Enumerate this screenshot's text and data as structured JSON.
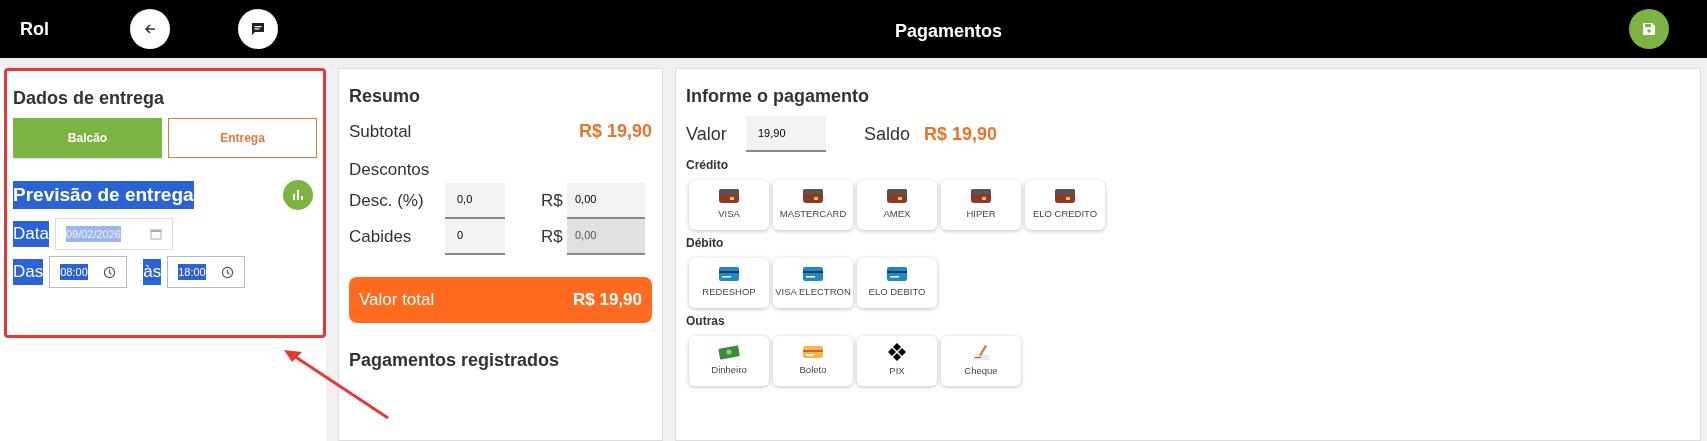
{
  "header": {
    "brand": "Rol",
    "title": "Pagamentos"
  },
  "delivery": {
    "title": "Dados de entrega",
    "highlighted": true,
    "modes": [
      {
        "label": "Balcão",
        "selected": true
      },
      {
        "label": "Entrega",
        "selected": false
      }
    ],
    "forecast": {
      "title": "Previsão de entrega",
      "text_selected": true,
      "date_label": "Data",
      "date_value": "09/02/2026",
      "from_label": "Das",
      "from_value": "08:00",
      "to_label": "às",
      "to_value": "18:00"
    }
  },
  "summary": {
    "title": "Resumo",
    "subtotal_label": "Subtotal",
    "subtotal_value": "R$ 19,90",
    "discounts_label": "Descontos",
    "rows": [
      {
        "label": "Desc. (%)",
        "value": "0,0",
        "currency": "R$",
        "amount": "0,00",
        "disabled": false
      },
      {
        "label": "Cabides",
        "value": "0",
        "currency": "R$",
        "amount": "0,00",
        "disabled": true
      }
    ],
    "total_label": "Valor total",
    "total_value": "R$ 19,90",
    "registered_title": "Pagamentos registrados"
  },
  "payment": {
    "title": "Informe o pagamento",
    "valor_label": "Valor",
    "valor_value": "19,90",
    "saldo_label": "Saldo",
    "saldo_value": "R$ 19,90",
    "groups": [
      {
        "title": "Crédito",
        "methods": [
          {
            "label": "VISA",
            "kind": "credit"
          },
          {
            "label": "MASTERCARD",
            "kind": "credit"
          },
          {
            "label": "AMEX",
            "kind": "credit"
          },
          {
            "label": "HIPER",
            "kind": "credit"
          },
          {
            "label": "ELO CREDITO",
            "kind": "credit"
          }
        ]
      },
      {
        "title": "Débito",
        "methods": [
          {
            "label": "REDESHOP",
            "kind": "debit"
          },
          {
            "label": "VISA ELECTRON",
            "kind": "debit"
          },
          {
            "label": "ELO DEBITO",
            "kind": "debit"
          }
        ]
      },
      {
        "title": "Outras",
        "methods": [
          {
            "label": "Dinheiro",
            "kind": "cash"
          },
          {
            "label": "Boleto",
            "kind": "boleto"
          },
          {
            "label": "PIX",
            "kind": "pix"
          },
          {
            "label": "Cheque",
            "kind": "cheque"
          }
        ]
      }
    ]
  }
}
